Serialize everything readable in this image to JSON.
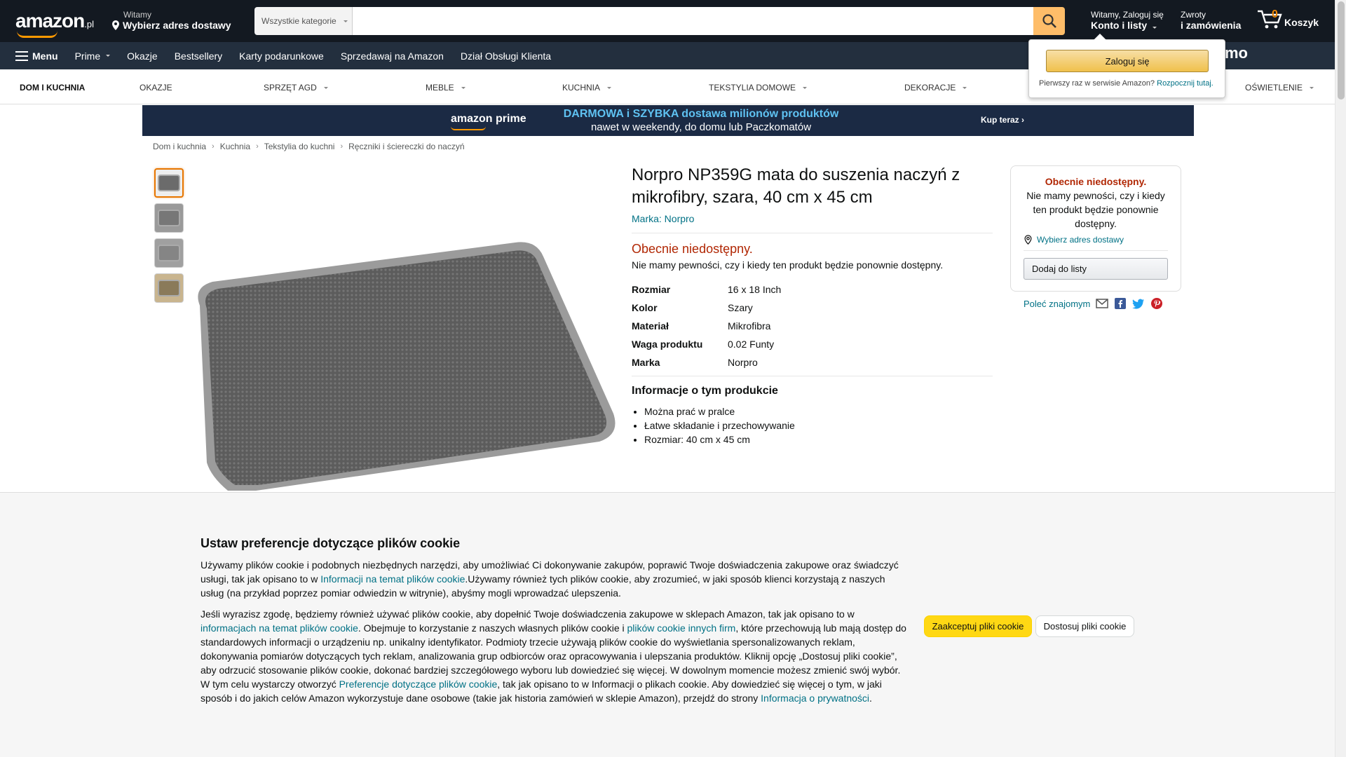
{
  "header": {
    "logo": "amazon",
    "logo_suffix": ".pl",
    "deliver_greeting": "Witamy",
    "deliver_address": "Wybierz adres dostawy",
    "search_category": "Wszystkie kategorie",
    "search_placeholder": "",
    "account_line1": "Witamy, Zaloguj się",
    "account_line2": "Konto i listy",
    "orders_line1": "Zwroty",
    "orders_line2": "i zamówienia",
    "cart_count": "0",
    "cart_label": "Koszyk"
  },
  "subnav": {
    "menu": "Menu",
    "items": [
      "Prime",
      "Okazje",
      "Bestsellery",
      "Karty podarunkowe",
      "Sprzedawaj na Amazon",
      "Dział Obsługi Klienta"
    ],
    "promo": "buj za darmo"
  },
  "categories": [
    "DOM I KUCHNIA",
    "OKAZJE",
    "SPRZĘT AGD",
    "MEBLE",
    "KUCHNIA",
    "TEKSTYLIA DOMOWE",
    "DEKORACJE",
    "OŚWIETLENIE"
  ],
  "banner": {
    "prime": "amazon prime",
    "line1": "DARMOWA i SZYBKA dostawa milionów produktów",
    "line2": "nawet w weekendy, do domu lub Paczkomatów",
    "cta": "Kup teraz ›"
  },
  "breadcrumb": [
    "Dom i kuchnia",
    "Kuchnia",
    "Tekstylia do kuchni",
    "Ręczniki i ściereczki do naczyń"
  ],
  "product": {
    "title": "Norpro NP359G mata do suszenia naczyń z mikrofibry, szara, 40 cm x 45 cm",
    "brand": "Marka: Norpro",
    "availability": "Obecnie niedostępny.",
    "availability_sub": "Nie mamy pewności, czy i kiedy ten produkt będzie ponownie dostępny.",
    "specs": [
      {
        "k": "Rozmiar",
        "v": "16 x 18 Inch"
      },
      {
        "k": "Kolor",
        "v": "Szary"
      },
      {
        "k": "Materiał",
        "v": "Mikrofibra"
      },
      {
        "k": "Waga produktu",
        "v": "0.02 Funty"
      },
      {
        "k": "Marka",
        "v": "Norpro"
      }
    ],
    "about_heading": "Informacje o tym produkcie",
    "bullets": [
      "Można prać w pralce",
      "Łatwe składanie i przechowywanie",
      "Rozmiar: 40 cm x 45 cm"
    ]
  },
  "buybox": {
    "title": "Obecnie niedostępny.",
    "text": "Nie mamy pewności, czy i kiedy ten produkt będzie ponownie dostępny.",
    "address": "Wybierz adres dostawy",
    "add_to_list": "Dodaj do listy",
    "share": "Poleć znajomym"
  },
  "flyout": {
    "signin": "Zaloguj się",
    "new_customer": "Pierwszy raz w serwisie Amazon?",
    "start_here": "Rozpocznij tutaj."
  },
  "cookie": {
    "heading": "Ustaw preferencje dotyczące plików cookie",
    "p1_a": "Używamy plików cookie i podobnych niezbędnych narzędzi, aby umożliwiać Ci dokonywanie zakupów, poprawić Twoje doświadczenia zakupowe oraz świadczyć usługi, tak jak opisano to w ",
    "p1_link": "Informacji na temat plików cookie",
    "p1_b": ".Używamy również tych plików cookie, aby zrozumieć, w jaki sposób klienci korzystają z naszych usług (na przykład poprzez pomiar odwiedzin w witrynie), abyśmy mogli wprowadzać ulepszenia.",
    "p2_a": "Jeśli wyrazisz zgodę, będziemy również używać plików cookie, aby dopełnić Twoje doświadczenia zakupowe w sklepach Amazon, tak jak opisano to w ",
    "p2_link1": "informacjach na temat plików cookie",
    "p2_b": ". Obejmuje to korzystanie z naszych własnych plików cookie i ",
    "p2_link2": "plików cookie innych firm",
    "p2_c": ", które przechowują lub mają dostęp do standardowych informacji o urządzeniu np. unikalny identyfikator. Podmioty trzecie używają plików cookie do wyświetlania spersonalizowanych reklam, dokonywania pomiarów dotyczących tych reklam, analizowania grup odbiorców oraz opracowywania i ulepszania produktów. Kliknij opcję „Dostosuj pliki cookie”, aby odrzucić stosowanie plików cookie, dokonać bardziej szczegółowego wyboru lub dowiedzieć się więcej. W dowolnym momencie możesz zmienić swój wybór. W tym celu wystarczy otworzyć ",
    "p2_link3": "Preferencje dotyczące plików cookie",
    "p2_d": ", tak jak opisano to w Informacji o plikach cookie. Aby dowiedzieć się więcej o tym, w jaki sposób i do jakich celów Amazon wykorzystuje dane osobowe (takie jak historia zamówień w sklepie Amazon), przejdź do strony ",
    "p2_link4": "Informacja o prywatności",
    "p2_e": ".",
    "accept": "Zaakceptuj pliki cookie",
    "customize": "Dostosuj pliki cookie"
  }
}
